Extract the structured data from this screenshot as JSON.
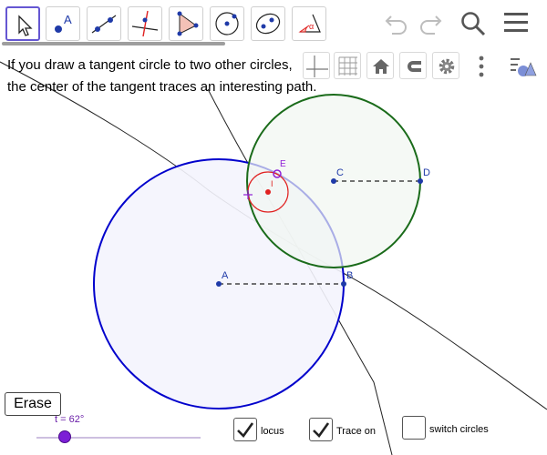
{
  "toolbar": {
    "tools": [
      {
        "id": "move",
        "icon": "move-arrow-icon"
      },
      {
        "id": "point",
        "icon": "point-icon"
      },
      {
        "id": "line",
        "icon": "line-icon"
      },
      {
        "id": "perpendicular",
        "icon": "perpendicular-line-icon"
      },
      {
        "id": "polygon",
        "icon": "polygon-icon"
      },
      {
        "id": "circle",
        "icon": "circle-center-point-icon"
      },
      {
        "id": "conic",
        "icon": "ellipse-icon"
      },
      {
        "id": "angle",
        "icon": "angle-icon"
      }
    ],
    "point_letter": "A",
    "angle_letter": "α",
    "right_icons": [
      "undo-icon",
      "redo-icon",
      "search-icon",
      "menu-icon"
    ]
  },
  "stylebar": {
    "buttons": [
      "axes-icon",
      "grid-icon",
      "home-icon",
      "snap-magnet-icon",
      "gear-icon",
      "more-vertical-icon",
      "shapes-icon"
    ]
  },
  "description": {
    "line1": "If you draw a tangent circle to two other circles,",
    "line2": "the center of the tangent traces an interesting path."
  },
  "labels": {
    "A": "A",
    "B": "B",
    "C": "C",
    "D": "D",
    "E": "E",
    "I": "I"
  },
  "colors": {
    "blue_circle": "#0000cc",
    "green_circle": "#1a6b1a",
    "red_circle": "#e02020",
    "point_blue": "#1f3aa8",
    "purple": "#8e1fd6",
    "accent": "#6557d2"
  },
  "controls": {
    "erase_label": "Erase",
    "slider_label": "t = 62°",
    "slider_value_deg": 62,
    "checkboxes": [
      {
        "id": "locus",
        "label": "locus",
        "checked": true
      },
      {
        "id": "trace",
        "label": "Trace on",
        "checked": true
      },
      {
        "id": "switch",
        "label": "switch circles",
        "checked": false
      }
    ]
  }
}
